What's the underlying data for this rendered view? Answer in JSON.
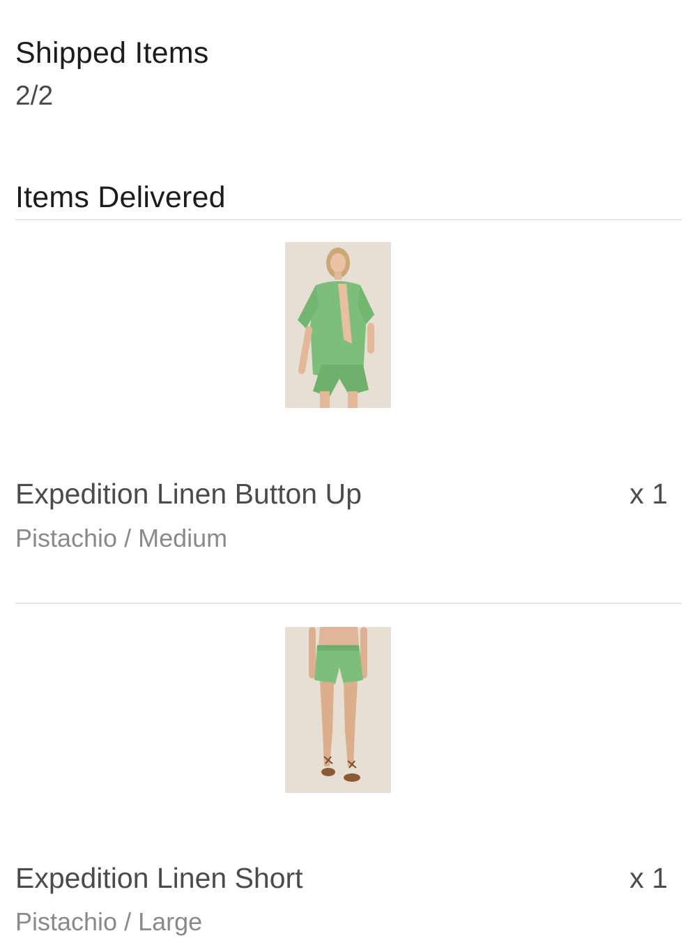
{
  "shipped": {
    "title": "Shipped Items",
    "count": "2/2"
  },
  "delivered": {
    "title": "Items Delivered"
  },
  "items": [
    {
      "name": "Expedition Linen Button Up",
      "variant": "Pistachio / Medium",
      "quantity": "x 1",
      "image_icon": "product-photo-shirt-and-shorts"
    },
    {
      "name": "Expedition Linen Short",
      "variant": "Pistachio / Large",
      "quantity": "x 1",
      "image_icon": "product-photo-shorts"
    }
  ],
  "colors": {
    "product_green": "#7dbf7a",
    "photo_background": "#e6ddd2",
    "divider": "#e4e4e4"
  }
}
